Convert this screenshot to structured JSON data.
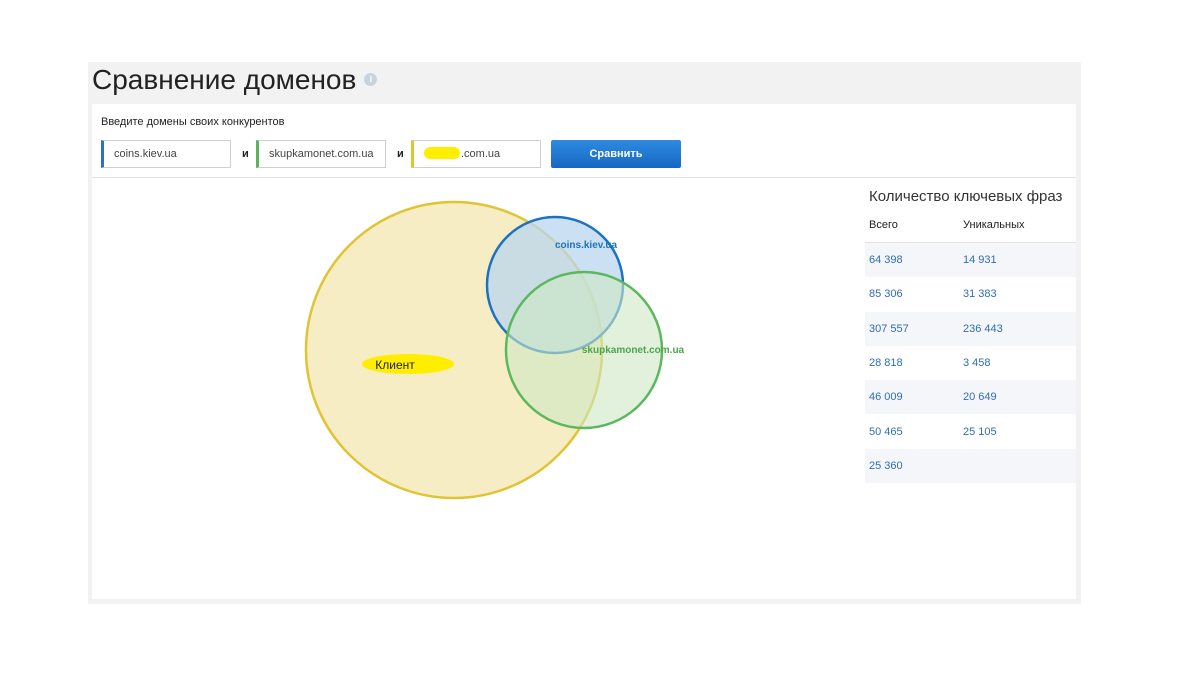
{
  "page": {
    "title": "Сравнение доменов",
    "info_icon": "i"
  },
  "form": {
    "label": "Введите домены своих конкурентов",
    "domain1": "coins.kiev.ua",
    "domain2": "skupkamonet.com.ua",
    "domain3_suffix": ".com.ua",
    "separator": "и",
    "compare_label": "Сравнить"
  },
  "venn": {
    "client_label": "Клиент",
    "domain1_label": "coins.kiev.ua",
    "domain2_label": "skupkamonet.com.ua",
    "colors": {
      "client": "#e0c433",
      "domain1": "#1d72c0",
      "domain2": "#5cb85c",
      "highlight": "#ffee00"
    }
  },
  "stats": {
    "title": "Количество ключевых фраз",
    "col_total": "Всего",
    "col_unique": "Уникальных",
    "rows": [
      {
        "total": "64 398",
        "unique": "14 931"
      },
      {
        "total": "85 306",
        "unique": "31 383"
      },
      {
        "total": "307 557",
        "unique": "236 443"
      },
      {
        "total": "28 818",
        "unique": "3 458"
      },
      {
        "total": "46 009",
        "unique": "20 649"
      },
      {
        "total": "50 465",
        "unique": "25 105"
      },
      {
        "total": "25 360",
        "unique": ""
      }
    ]
  }
}
